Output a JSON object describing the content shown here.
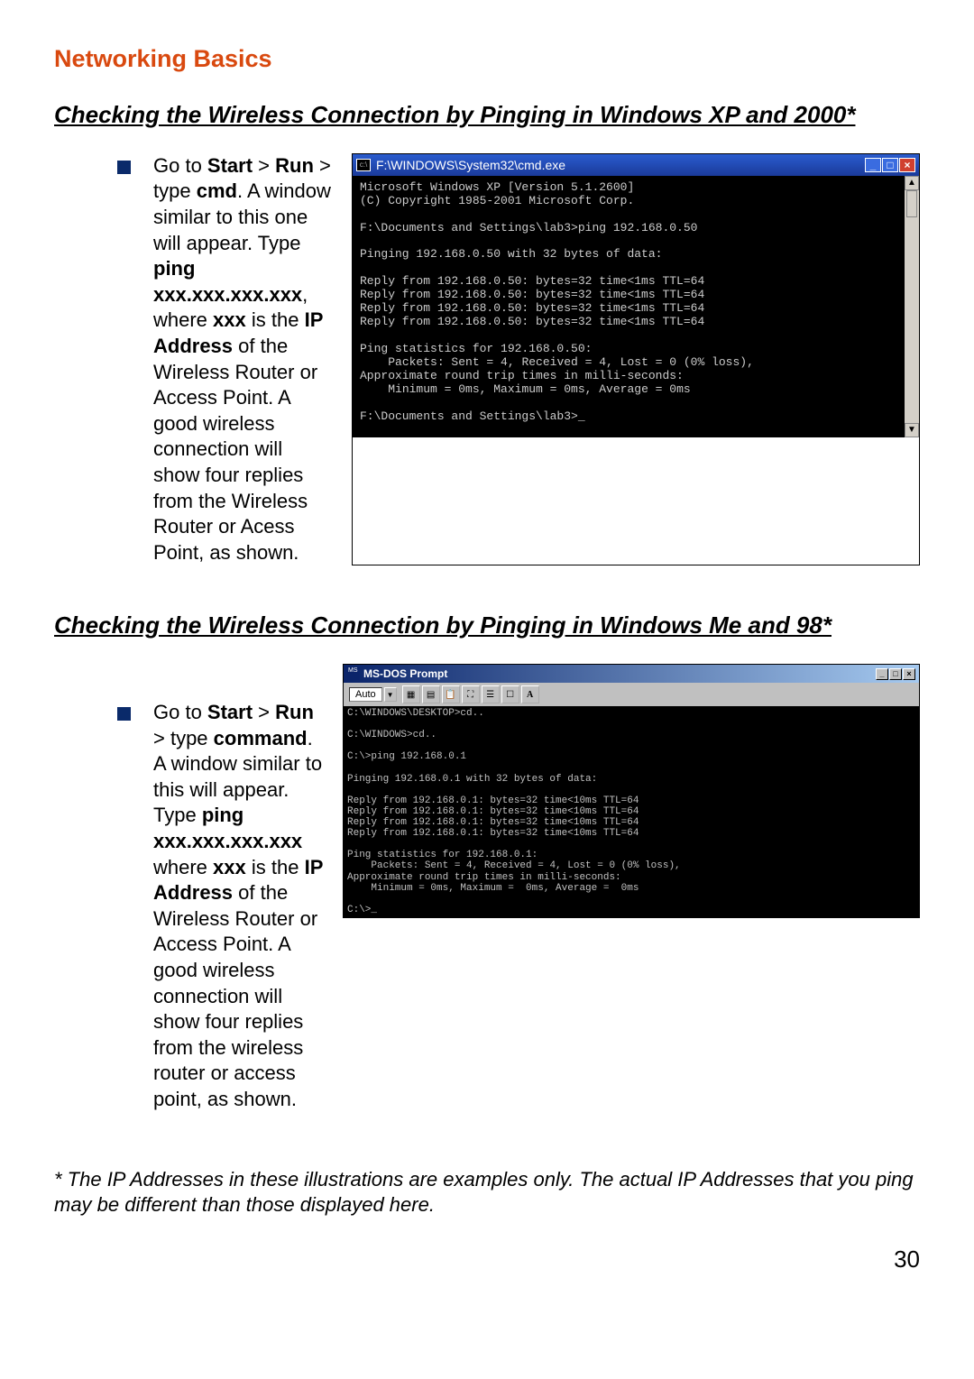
{
  "page_title": "Networking Basics",
  "section1_heading": "Checking the Wireless Connection by Pinging in Windows XP and 2000*",
  "section2_heading": "Checking the Wireless Connection by Pinging in Windows Me and 98*",
  "bullet1_html": "Go to <b>Start</b> > <b>Run</b> > type <b>cmd</b>.  A window similar to this one will appear.  Type <b>ping xxx.xxx.xxx.xxx</b>, where <b>xxx</b> is the <b>IP Address</b> of the Wireless Router or Access Point.  A good wireless connection will show four replies from the Wireless Router or Acess Point, as shown.",
  "bullet2_html": "Go to <b>Start</b> > <b>Run</b> > type <b>command</b>.  A window similar to this will appear.  Type <b>ping xxx.xxx.xxx.xxx</b> where <b>xxx</b> is the <b>IP Address</b> of the Wireless Router or Access Point.  A good wireless connection will show four replies from the wireless router or access point, as shown.",
  "xp_window": {
    "icon": "c:\\",
    "title": "F:\\WINDOWS\\System32\\cmd.exe",
    "console": "Microsoft Windows XP [Version 5.1.2600]\n(C) Copyright 1985-2001 Microsoft Corp.\n\nF:\\Documents and Settings\\lab3>ping 192.168.0.50\n\nPinging 192.168.0.50 with 32 bytes of data:\n\nReply from 192.168.0.50: bytes=32 time<1ms TTL=64\nReply from 192.168.0.50: bytes=32 time<1ms TTL=64\nReply from 192.168.0.50: bytes=32 time<1ms TTL=64\nReply from 192.168.0.50: bytes=32 time<1ms TTL=64\n\nPing statistics for 192.168.0.50:\n    Packets: Sent = 4, Received = 4, Lost = 0 (0% loss),\nApproximate round trip times in milli-seconds:\n    Minimum = 0ms, Maximum = 0ms, Average = 0ms\n\nF:\\Documents and Settings\\lab3>_"
  },
  "w98_window": {
    "title": "MS-DOS Prompt",
    "auto_label": "Auto",
    "toolbar_a": "A",
    "console": "C:\\WINDOWS\\DESKTOP>cd..\n\nC:\\WINDOWS>cd..\n\nC:\\>ping 192.168.0.1\n\nPinging 192.168.0.1 with 32 bytes of data:\n\nReply from 192.168.0.1: bytes=32 time<10ms TTL=64\nReply from 192.168.0.1: bytes=32 time<10ms TTL=64\nReply from 192.168.0.1: bytes=32 time<10ms TTL=64\nReply from 192.168.0.1: bytes=32 time<10ms TTL=64\n\nPing statistics for 192.168.0.1:\n    Packets: Sent = 4, Received = 4, Lost = 0 (0% loss),\nApproximate round trip times in milli-seconds:\n    Minimum = 0ms, Maximum =  0ms, Average =  0ms\n\nC:\\>_"
  },
  "footnote": "* The IP Addresses in these illustrations are examples only.  The actual IP Addresses that you ping may be different than those displayed here.",
  "page_number": "30"
}
